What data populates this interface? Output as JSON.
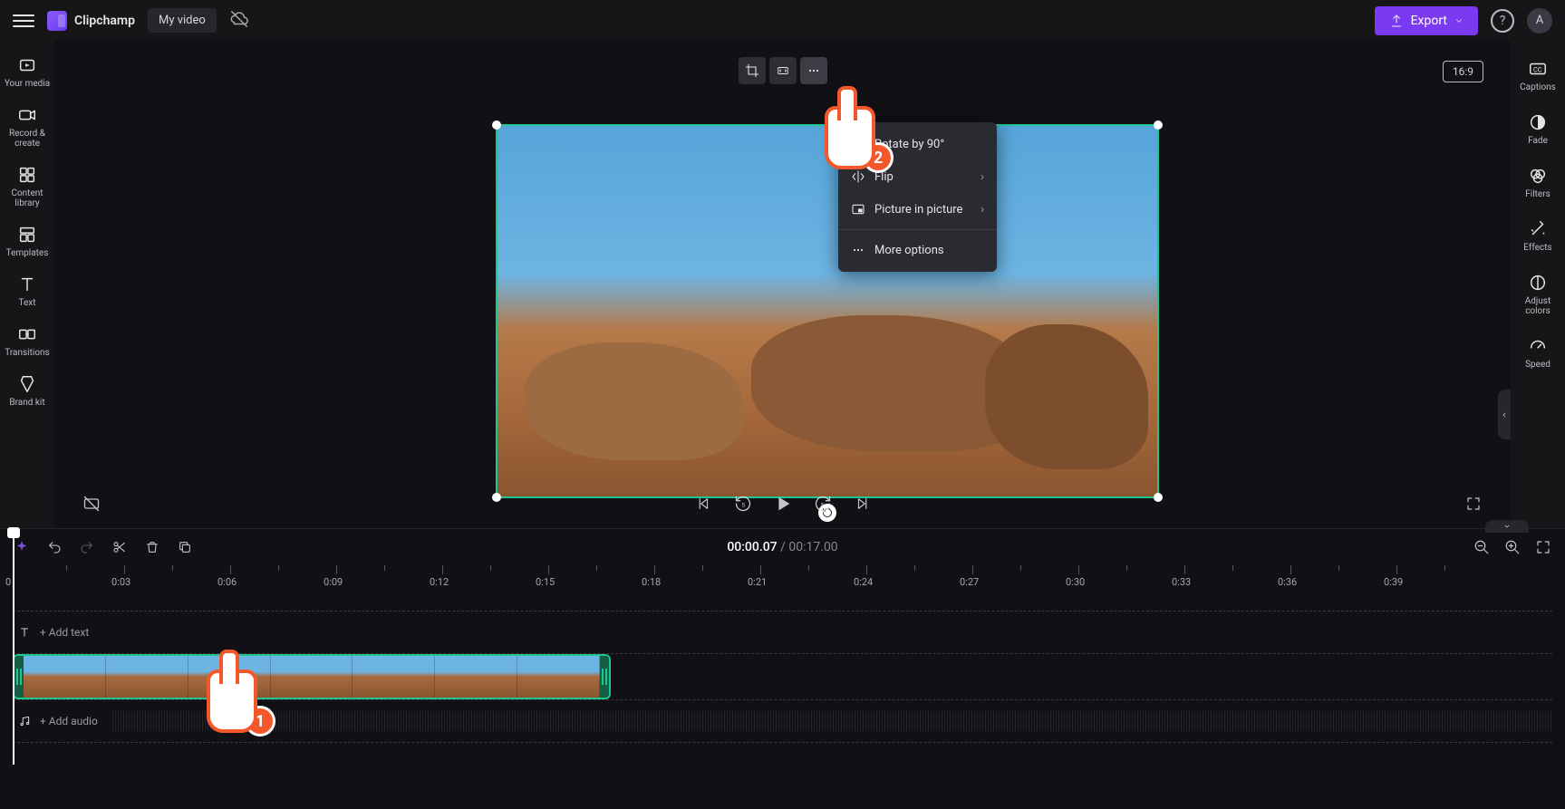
{
  "header": {
    "app_name": "Clipchamp",
    "project_name": "My video",
    "export_label": "Export",
    "avatar_initial": "A"
  },
  "left_rail": {
    "items": [
      {
        "id": "your-media",
        "label": "Your media"
      },
      {
        "id": "record-create",
        "label": "Record & create"
      },
      {
        "id": "content-library",
        "label": "Content library"
      },
      {
        "id": "templates",
        "label": "Templates"
      },
      {
        "id": "text",
        "label": "Text"
      },
      {
        "id": "transitions",
        "label": "Transitions"
      },
      {
        "id": "brand-kit",
        "label": "Brand kit"
      }
    ]
  },
  "right_rail": {
    "items": [
      {
        "id": "captions",
        "label": "Captions"
      },
      {
        "id": "fade",
        "label": "Fade"
      },
      {
        "id": "filters",
        "label": "Filters"
      },
      {
        "id": "effects",
        "label": "Effects"
      },
      {
        "id": "adjust-colors",
        "label": "Adjust colors"
      },
      {
        "id": "speed",
        "label": "Speed"
      }
    ]
  },
  "canvas": {
    "aspect_label": "16:9"
  },
  "context_menu": {
    "rotate_label": "Rotate by 90°",
    "flip_label": "Flip",
    "pip_label": "Picture in picture",
    "more_label": "More options"
  },
  "annotations": {
    "cursor_1": "1",
    "cursor_2": "2"
  },
  "timeline": {
    "current_time": "00:00.07",
    "separator": " / ",
    "total_time": "00:17.00",
    "ruler_marks": [
      "0",
      "0:03",
      "0:06",
      "0:09",
      "0:12",
      "0:15",
      "0:18",
      "0:21",
      "0:24",
      "0:27",
      "0:30",
      "0:33",
      "0:36",
      "0:39"
    ],
    "add_text_label": "+  Add text",
    "add_audio_label": "+  Add audio"
  }
}
